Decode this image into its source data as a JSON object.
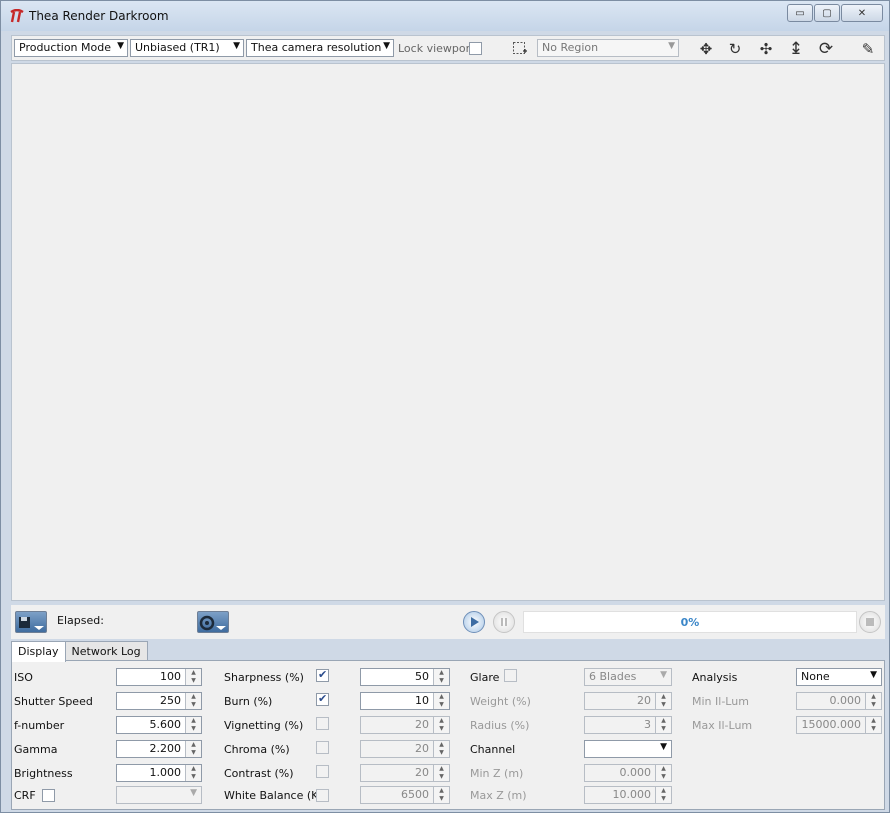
{
  "window": {
    "title": "Thea Render Darkroom",
    "minimize_glyph": "▭",
    "maximize_glyph": "▢",
    "close_glyph": "✕"
  },
  "toolbar": {
    "mode": "Production Mode",
    "engine": "Unbiased (TR1)",
    "resolution": "Thea camera resolution",
    "lock_viewport_label": "Lock viewport",
    "lock_viewport_checked": false,
    "region": "No Region",
    "icons": [
      "move-icon",
      "rotate-icon",
      "pan-icon",
      "up-down-icon",
      "refresh-icon",
      "brush-icon"
    ],
    "glyphs": {
      "move": "✥",
      "rotate": "↻",
      "pan": "✣",
      "updown": "↨",
      "refresh": "⟳",
      "brush": "✎"
    }
  },
  "status": {
    "elapsed_label": "Elapsed:",
    "elapsed_value": "",
    "progress_text": "0%",
    "progress_fraction": 0
  },
  "tabs": [
    {
      "label": "Display",
      "active": true
    },
    {
      "label": "Network Log",
      "active": false
    }
  ],
  "display": {
    "col1": {
      "iso_label": "ISO",
      "iso": "100",
      "shutter_label": "Shutter Speed",
      "shutter": "250",
      "fnumber_label": "f-number",
      "fnumber": "5.600",
      "gamma_label": "Gamma",
      "gamma": "2.200",
      "brightness_label": "Brightness",
      "brightness": "1.000",
      "crf_label": "CRF",
      "crf_checked": false,
      "crf_value": ""
    },
    "col2": {
      "sharpness_label": "Sharpness (%)",
      "sharpness_checked": true,
      "sharpness": "50",
      "burn_label": "Burn (%)",
      "burn_checked": true,
      "burn": "10",
      "vignetting_label": "Vignetting (%)",
      "vignetting_checked": false,
      "vignetting": "20",
      "chroma_label": "Chroma (%)",
      "chroma_checked": false,
      "chroma": "20",
      "contrast_label": "Contrast (%)",
      "contrast_checked": false,
      "contrast": "20",
      "wb_label": "White Balance (K)",
      "wb_checked": false,
      "wb": "6500"
    },
    "col3": {
      "glare_label": "Glare",
      "glare_checked": false,
      "glare_blades": "6 Blades",
      "weight_label": "Weight (%)",
      "weight": "20",
      "radius_label": "Radius (%)",
      "radius": "3",
      "channel_label": "Channel",
      "channel": "",
      "minz_label": "Min Z (m)",
      "minz": "0.000",
      "maxz_label": "Max Z (m)",
      "maxz": "10.000"
    },
    "col4": {
      "analysis_label": "Analysis",
      "analysis": "None",
      "minil_label": "Min Il-Lum",
      "minil": "0.000",
      "maxil_label": "Max Il-Lum",
      "maxil": "15000.000"
    }
  },
  "colors": {
    "accent": "#3a86c8",
    "title_bar": "#c5d5e8"
  }
}
